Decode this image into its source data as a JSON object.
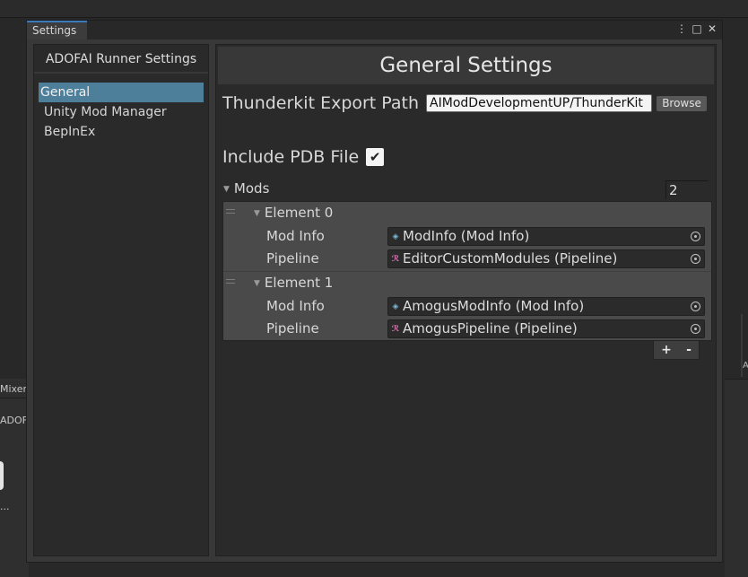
{
  "background": {
    "mixer_tab": "Mixer",
    "adofai_text": "ADOFAIM",
    "ellipsis": "...",
    "right_letter": "A"
  },
  "window": {
    "tab_title": "Settings",
    "controls": [
      "⋮",
      "□",
      "✕"
    ]
  },
  "nav": {
    "header": "ADOFAI Runner Settings",
    "items": [
      {
        "label": "General",
        "active": true
      },
      {
        "label": "Unity Mod Manager",
        "active": false
      },
      {
        "label": "BepInEx",
        "active": false
      }
    ]
  },
  "content": {
    "title": "General Settings",
    "export_path_label": "Thunderkit Export Path",
    "export_path_value": "AIModDevelopmentUP/ThunderKit",
    "browse_label": "Browse",
    "include_pdb_label": "Include PDB File",
    "include_pdb_checked": true,
    "checkmark": "✔",
    "mods_label": "Mods",
    "mods_count": "2",
    "elements": [
      {
        "title": "Element 0",
        "mod_info_label": "Mod Info",
        "mod_info_value": "ModInfo (Mod Info)",
        "pipeline_label": "Pipeline",
        "pipeline_value": "EditorCustomModules (Pipeline)"
      },
      {
        "title": "Element 1",
        "mod_info_label": "Mod Info",
        "mod_info_value": "AmogusModInfo (Mod Info)",
        "pipeline_label": "Pipeline",
        "pipeline_value": "AmogusPipeline (Pipeline)"
      }
    ],
    "add_label": "+",
    "remove_label": "-"
  },
  "icons": {
    "foldout": "▼",
    "mod_info_icon": "modinfo-asset-icon",
    "pipeline_icon": "pipeline-asset-icon",
    "picker_icon": "object-picker-icon"
  }
}
